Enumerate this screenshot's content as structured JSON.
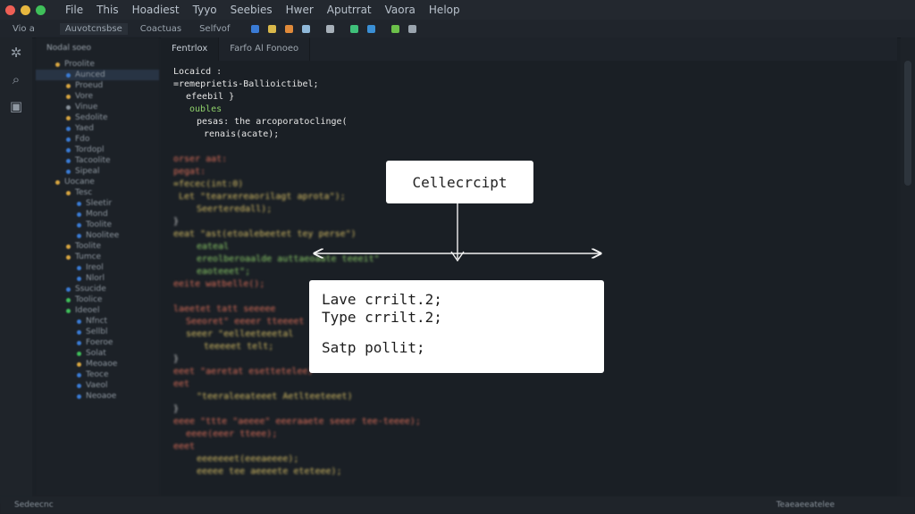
{
  "menu": [
    "File",
    "This",
    "Hoadiest",
    "Tyyo",
    "Seebies",
    "Hwer",
    "Aputrrat",
    "Vaora",
    "Helop"
  ],
  "toolbar": {
    "left_label": "Vio a",
    "btn1": "Auvotcnsbse",
    "btn2": "Coactuas",
    "btn3": "Selfvof"
  },
  "explorer": {
    "header": "Nodal soeo",
    "items": [
      "Proolite",
      "Aunced",
      "Proeud",
      "Vore",
      "Vinue",
      "Sedolite",
      "Yaed",
      "Fdo",
      "Tordopl",
      "Tacoolite",
      "Sipeal",
      "Uocane",
      "Tesc",
      "Sleetir",
      "Mond",
      "Toolite",
      "Noolitee",
      "Toolite",
      "Tumce",
      "Ireol",
      "Nlorl",
      "Ssucide",
      "Toolice",
      "Ideoel",
      "Nfnct",
      "Sellbl",
      "Foeroe",
      "Solat",
      "Meoaoe",
      "Teoce",
      "Vaeol",
      "Neoaoe"
    ]
  },
  "tabs": [
    "Fentrlox",
    "Farfo Al Fonoeo"
  ],
  "code": {
    "l1": "Locaicd :",
    "l2": "=remeprietis-Ballioictibel;",
    "l3": "efeebil }",
    "l4": "oubles",
    "l5": "pesas: the arcoporatoclinge(",
    "l6": "renais(acate);",
    "l7": "orser aat:",
    "l8": "pegat:",
    "l9": "=fecec(int:0)",
    "l10": "Let \"tearxereaorilagt aprota\");",
    "l11": "Seerteredall);",
    "l12": "}",
    "l13": "eeat \"ast(etoalebeetet tey perse\")",
    "l14": "eateal",
    "l15": "ereolberoaalde auttaeoaate teeeit\"",
    "l16": "eaoteeet\";",
    "l17": "eeite watbelle();",
    "l18": "laeetet tatt seeeee",
    "l19": "Seeoret\" eeeer tteeeet",
    "l20": "seeer \"eelleeteeetal",
    "l21": "teeeeet telt;",
    "l22": "}",
    "l23": "eeet \"aeretat esettetelee)",
    "l24": "eet",
    "l25": "\"teeraleeateeet Aetlteeteeet)",
    "l26": "}",
    "l27": "eeee \"ttte \"aeeee\" eeeraaete seeer tee-teeee);",
    "l28": "eeee(eeer tteee);",
    "l29": "eeet",
    "l30": "eeeeeeet(eeeaeeee);",
    "l31": "eeeee tee aeeeete eteteee);"
  },
  "callout_top": "Cellecrcipt",
  "callout_bottom": {
    "line1": "Lave crrilt.2;",
    "line2": "Type crrilt.2;",
    "line3": "Satp pollit;"
  },
  "status": {
    "left": "Sedeecnc",
    "right": "Teaeaeeatelee"
  },
  "colors": {
    "keyword": "#e0705a",
    "string": "#d9c066",
    "green": "#8fd16a",
    "callout_bg": "#ffffff"
  }
}
